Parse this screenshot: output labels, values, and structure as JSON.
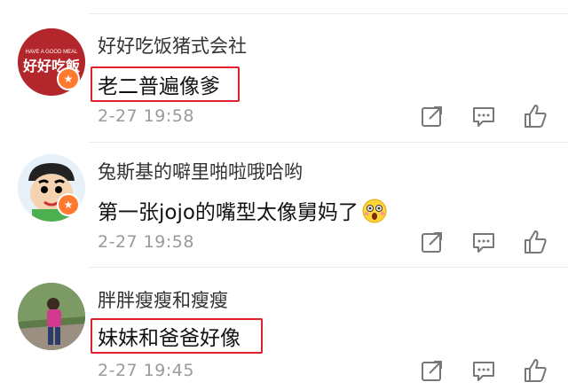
{
  "comments": [
    {
      "username": "好好吃饭猪式会社",
      "text": "老二普遍像爹",
      "time": "2-27 19:58",
      "avatar_text_top": "HAVE A GOOD MEAL",
      "avatar_text_main": "好好吃飯",
      "highlighted": true
    },
    {
      "username": "兔斯基的噼里啪啦哦哈哟",
      "text": "第一张jojo的嘴型太像舅妈了",
      "time": "2-27 19:58",
      "emoji": "astonished-face-icon",
      "highlighted": false
    },
    {
      "username": "胖胖瘦瘦和瘦瘦",
      "text": "妹妹和爸爸好像",
      "time": "2-27 19:45",
      "highlighted": true
    }
  ],
  "colors": {
    "highlight": "#e0202a",
    "badge": "#ff7a2f",
    "time": "#9a9a9a"
  },
  "icons": [
    "share-icon",
    "comment-icon",
    "like-icon"
  ]
}
